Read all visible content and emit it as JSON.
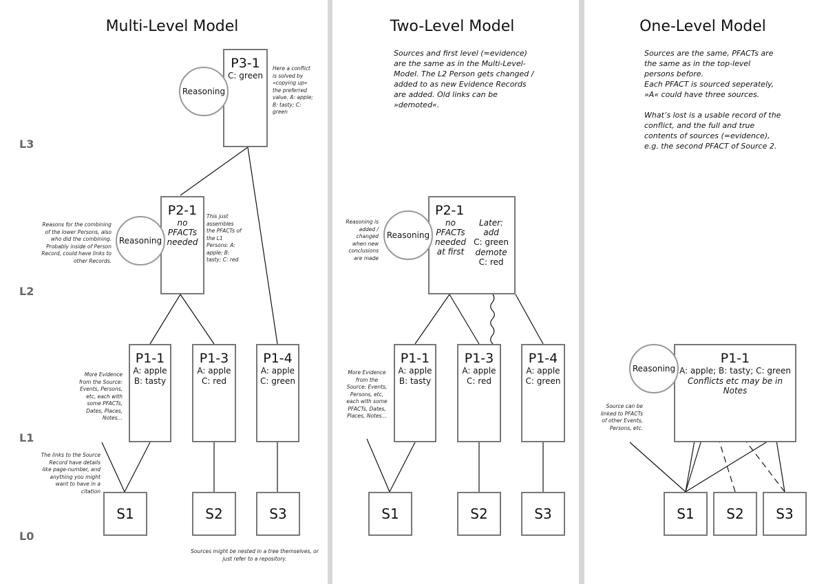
{
  "levels": [
    "L3",
    "L2",
    "L1",
    "L0"
  ],
  "multi": {
    "title": "Multi-Level Model",
    "p3": {
      "name": "P3-1",
      "line1": "C: green"
    },
    "p3_note": "Here a conflict is solved by »copying up« the preferred value. A: apple; B: tasty; C: green",
    "reasoning": "Reasoning",
    "p2": {
      "name": "P2-1",
      "line1": "no",
      "line2": "PFACTs",
      "line3": "needed"
    },
    "p2_note_left": "Reasons for the combining of the lower Persons, also who did the combining. Probably inside of Person Record, could have links to other Records.",
    "p2_note_right": "This just assembles the PFACTs of the L1 Persons: A: apple; B: tasty; C: red",
    "p1": [
      {
        "name": "P1-1",
        "line1": "A: apple",
        "line2": "B: tasty"
      },
      {
        "name": "P1-3",
        "line1": "A: apple",
        "line2": "C: red"
      },
      {
        "name": "P1-4",
        "line1": "A: apple",
        "line2": "C: green"
      }
    ],
    "evidence_note": "More Evidence from the Source: Events, Persons, etc, each with some PFACTs, Dates, Places, Notes…",
    "links_note": "The links to the Source Record have details like page-number, and anything you might want to have in a citation",
    "sources": [
      "S1",
      "S2",
      "S3"
    ],
    "sources_note": "Sources might be nested in a tree themselves, or just refer to a repository."
  },
  "two": {
    "title": "Two-Level Model",
    "intro": "Sources and first level (=evidence) are the same as in the Multi-Level-Model. The L2 Person gets changed / added to as new Evidence Records are added. Old links can be »demoted«.",
    "reasoning": "Reasoning",
    "reasoning_note": "Reasoning is added / changed when new conclusions are made",
    "p2": {
      "name": "P2-1",
      "l1": "no",
      "l2": "PFACTs",
      "l3": "needed",
      "l4": "at first",
      "r1": "Later:",
      "r2": "add",
      "r3": "C: green",
      "r4": "demote",
      "r5": "C: red"
    },
    "p1": [
      {
        "name": "P1-1",
        "line1": "A: apple",
        "line2": "B: tasty"
      },
      {
        "name": "P1-3",
        "line1": "A: apple",
        "line2": "C: red"
      },
      {
        "name": "P1-4",
        "line1": "A: apple",
        "line2": "C: green"
      }
    ],
    "evidence_note": "More Evidence from the Source: Events, Persons, etc, each with some PFACTs, Dates, Places, Notes…",
    "sources": [
      "S1",
      "S2",
      "S3"
    ]
  },
  "one": {
    "title": "One-Level Model",
    "intro1": "Sources are the same, PFACTs are the same as in the top-level persons before.",
    "intro2": "Each PFACT is sourced seperately, »A« could have three sources.",
    "intro3": "What’s lost is a usable record of the conflict, and the full and true contents of sources (=evidence), e.g. the second PFACT of Source 2.",
    "reasoning": "Reasoning",
    "p1": {
      "name": "P1-1",
      "line1": "A: apple; B: tasty; C: green",
      "line2": "Conflicts etc may be in Notes"
    },
    "source_note": "Source can be linked to PFACTs of other Events, Persons, etc.",
    "sources": [
      "S1",
      "S2",
      "S3"
    ]
  }
}
